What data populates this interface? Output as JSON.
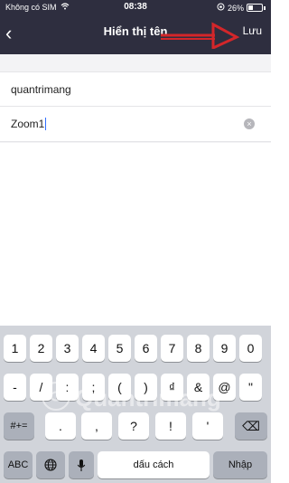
{
  "status_bar": {
    "carrier": "Không có SIM",
    "time": "08:38",
    "battery": "26%"
  },
  "nav": {
    "back_glyph": "‹",
    "title": "Hiển thị tên",
    "save_label": "Lưu"
  },
  "fields": {
    "first_value": "quantrimang",
    "second_value": "Zoom1",
    "clear_glyph": "×"
  },
  "keyboard": {
    "row1": [
      "1",
      "2",
      "3",
      "4",
      "5",
      "6",
      "7",
      "8",
      "9",
      "0"
    ],
    "row2": [
      "-",
      "/",
      ":",
      ";",
      "(",
      ")",
      "₫",
      "&",
      "@",
      "\""
    ],
    "row3_left": "#+=",
    "row3_keys": [
      ".",
      ",",
      "?",
      "!",
      "'"
    ],
    "row3_right_glyph": "⌫",
    "row4": {
      "abc": "ABC",
      "space": "dấu cách",
      "return": "Nhập"
    }
  },
  "watermark": {
    "text": "Quantrimang"
  },
  "colors": {
    "header_bg": "#2e2e3f",
    "keyboard_bg": "#d1d4da",
    "arrow": "#d3262a"
  }
}
